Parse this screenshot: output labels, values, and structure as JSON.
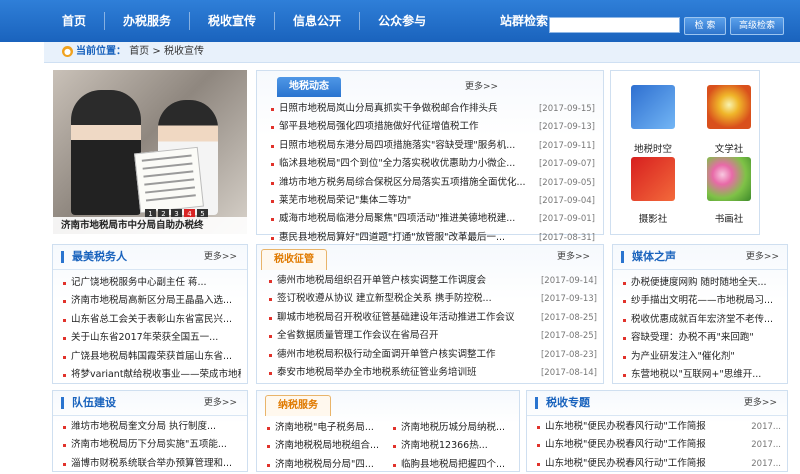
{
  "nav": {
    "items": [
      "首页",
      "办税服务",
      "税收宣传",
      "信息公开",
      "公众参与"
    ]
  },
  "search": {
    "label": "站群检索",
    "value": "",
    "button": "检 索",
    "advanced": "高级检索"
  },
  "breadcrumb": {
    "label": "当前位置：",
    "home": "首页",
    "sep": ">",
    "current": "税收宣传"
  },
  "slideshow": {
    "caption": "济南市地税局市中分局自助办税终",
    "pages": [
      "1",
      "2",
      "3",
      "4",
      "5"
    ],
    "active_page": "4"
  },
  "local_news": {
    "title": "地税动态",
    "more": "更多>>",
    "items": [
      {
        "text": "日照市地税局岚山分局真抓实干争做税邮合作排头兵",
        "date": "[2017-09-15]"
      },
      {
        "text": "邹平县地税局强化四项措施做好代征增值税工作",
        "date": "[2017-09-13]"
      },
      {
        "text": "日照市地税局东港分局四项措施落实\"容缺受理\"服务机...",
        "date": "[2017-09-11]"
      },
      {
        "text": "临沭县地税局\"四个到位\"全力落实税收优惠助力小微企...",
        "date": "[2017-09-07]"
      },
      {
        "text": "潍坊市地方税务局综合保税区分局落实五项措施全面优化...",
        "date": "[2017-09-05]"
      },
      {
        "text": "莱芜市地税局荣记\"集体二等功\"",
        "date": "[2017-09-04]"
      },
      {
        "text": "威海市地税局临港分局聚焦\"四项活动\"推进美德地税建...",
        "date": "[2017-09-01]"
      },
      {
        "text": "惠民县地税局算好\"四道题\"打通\"放管服\"改革最后一...",
        "date": "[2017-08-31]"
      }
    ]
  },
  "tiles": {
    "items": [
      "地税时空",
      "文学社",
      "摄影社",
      "书画社"
    ]
  },
  "best_taxpayer": {
    "title": "最美税务人",
    "more": "更多>>",
    "items": [
      "记广饶地税服务中心副主任 蒋...",
      "济南市地税局高新区分局王晶晶入选...",
      "山东省总工会关于表彰山东省富民兴...",
      "关于山东省2017年荣获全国五一...",
      "广饶县地税局韩国霞荣获首届山东省...",
      "将梦variant献给税收事业——荣成市地税..."
    ]
  },
  "collection": {
    "title": "税收征管",
    "more": "更多>>",
    "items": [
      {
        "text": "德州市地税局组织召开单管户核实调整工作调度会",
        "date": "[2017-09-14]"
      },
      {
        "text": "签订税收遵从协议 建立新型税企关系 携手防控税...",
        "date": "[2017-09-13]"
      },
      {
        "text": "聊城市地税局召开税收征管基础建设年活动推进工作会议",
        "date": "[2017-08-25]"
      },
      {
        "text": "全省数据质量管理工作会议在省局召开",
        "date": "[2017-08-25]"
      },
      {
        "text": "德州市地税局积极行动全面调开单管户核实调整工作",
        "date": "[2017-08-23]"
      },
      {
        "text": "泰安市地税局举办全市地税系统征管业务培训班",
        "date": "[2017-08-14]"
      }
    ]
  },
  "media": {
    "title": "媒体之声",
    "more": "更多>>",
    "items": [
      "办税便捷度网购 随时随地全天...",
      "纱手描出文明花——市地税局习...",
      "税收优惠成就百年宏济堂不老传...",
      "容缺受理：办税不再\"来回跑\"",
      "为产业研发注入\"催化剂\"",
      "东营地税以\"互联网+\"思维开..."
    ]
  },
  "team": {
    "title": "队伍建设",
    "more": "更多>>",
    "items": [
      "潍坊市地税局奎文分局 执行制度...",
      "济南市地税局历下分局实施\"五项能...",
      "淄博市财税系统联合举办预算管理和..."
    ]
  },
  "taxpayer_service": {
    "title": "纳税服务",
    "more": "更多>>",
    "left": [
      "济南地税\"电子税务局...",
      "济南地税税局地税组合...",
      "济南地税税局分局\"四..."
    ],
    "right": [
      "济南地税历城分局纳税...",
      "济南地税12366热...",
      "临朐县地税局把握四个..."
    ]
  },
  "special": {
    "title": "税收专题",
    "more": "更多>>",
    "items": [
      {
        "text": "山东地税\"便民办税春风行动\"工作简报",
        "date": "2017..."
      },
      {
        "text": "山东地税\"便民办税春风行动\"工作简报",
        "date": "2017..."
      },
      {
        "text": "山东地税\"便民办税春风行动\"工作简报",
        "date": "2017..."
      }
    ]
  },
  "colors": {
    "nav_bg": "#1a63bd",
    "accent_red": "#e1322b",
    "accent_orange": "#e07a00"
  }
}
